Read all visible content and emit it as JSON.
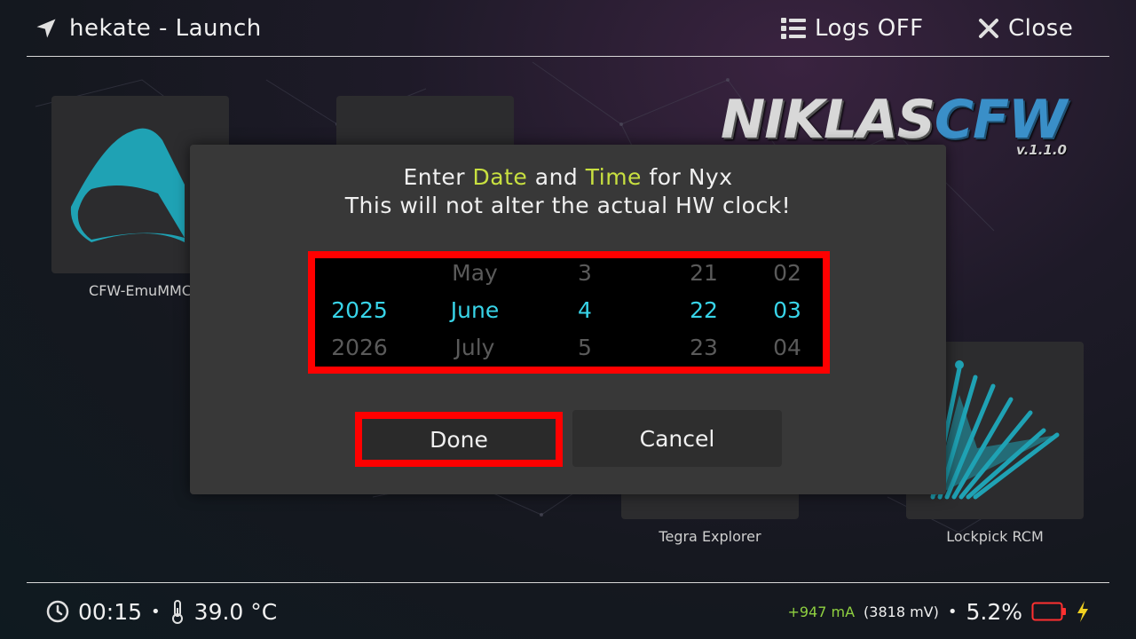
{
  "header": {
    "title": "hekate - Launch",
    "logs_label": "Logs OFF",
    "close_label": "Close"
  },
  "tiles": [
    {
      "label": "CFW-EmuMMC"
    },
    {
      "label": "Tegra Explorer"
    },
    {
      "label": "Lockpick RCM"
    }
  ],
  "logo": {
    "text_part1": "NIKLAS",
    "text_part2": "CFW",
    "version": "v.1.1.0"
  },
  "dialog": {
    "line1_pre": "Enter",
    "line1_hl1": "Date",
    "line1_mid": "and",
    "line1_hl2": "Time",
    "line1_post": "for Nyx",
    "line2": "This will not alter the actual HW clock!",
    "rollers": {
      "year": [
        "",
        "2025",
        "2026"
      ],
      "month": [
        "May",
        "June",
        "July"
      ],
      "day": [
        "3",
        "4",
        "5"
      ],
      "hour": [
        "21",
        "22",
        "23"
      ],
      "minute": [
        "02",
        "03",
        "04"
      ]
    },
    "done_label": "Done",
    "cancel_label": "Cancel"
  },
  "footer": {
    "time": "00:15",
    "separator": "•",
    "temperature": "39.0 °C",
    "current": "+947 mA",
    "voltage": "(3818 mV)",
    "battery_percent": "5.2%"
  },
  "colors": {
    "accent": "#38d4e8",
    "highlight": "#c8e040",
    "focus_border": "#ff0000",
    "battery_low": "#ff3030",
    "charging": "#f0d020"
  }
}
